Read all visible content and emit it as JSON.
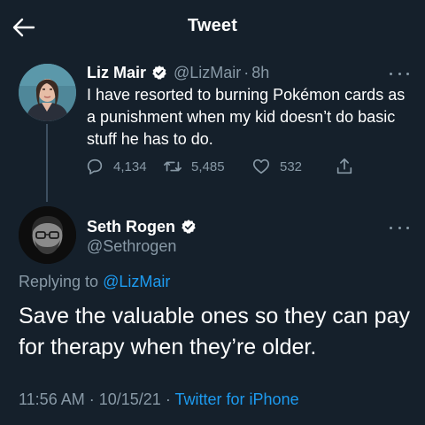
{
  "header": {
    "title": "Tweet",
    "back_icon": "arrow-left-icon"
  },
  "parent_tweet": {
    "display_name": "Liz Mair",
    "handle": "@LizMair",
    "separator": "·",
    "time": "8h",
    "text": "I have resorted to burning Pokémon cards as a punishment when my kid doesn’t do basic stuff he has to do.",
    "replies": "4,134",
    "retweets": "5,485",
    "likes": "532",
    "verified_icon": "verified-badge-icon",
    "more_icon": "more-dots-icon"
  },
  "main_tweet": {
    "display_name": "Seth Rogen",
    "handle": "@Sethrogen",
    "replying_prefix": "Replying to",
    "replying_to": "@LizMair",
    "text": "Save the valuable ones so they can pay for therapy when they’re older.",
    "time": "11:56 AM",
    "date_separator": "·",
    "date": "10/15/21",
    "source_separator": "·",
    "source": "Twitter for iPhone",
    "verified_icon": "verified-badge-icon",
    "more_icon": "more-dots-icon"
  },
  "colors": {
    "background": "#15202b",
    "text": "#ffffff",
    "secondary_text": "#8899a6",
    "accent": "#1d9bf0",
    "thread_line": "#3d4f60"
  }
}
